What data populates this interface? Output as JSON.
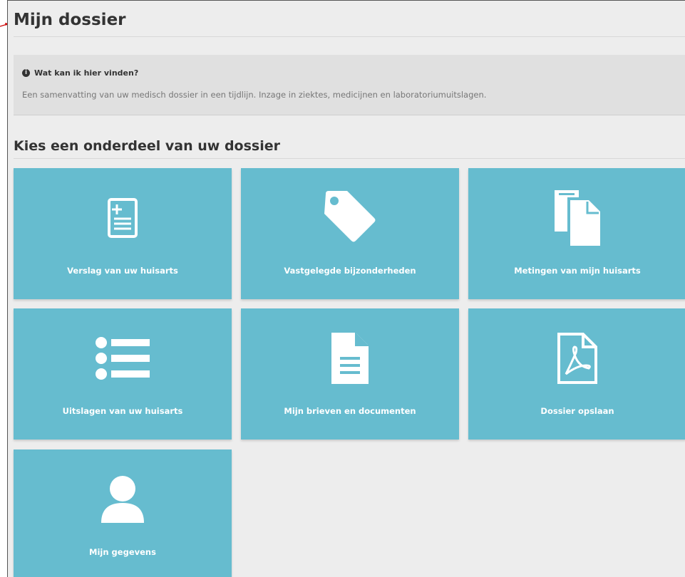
{
  "page": {
    "title": "Mijn dossier"
  },
  "info": {
    "heading": "Wat kan ik hier vinden?",
    "text": "Een samenvatting van uw medisch dossier in een tijdlijn. Inzage in ziektes, medicijnen en laboratoriumuitslagen."
  },
  "section": {
    "title": "Kies een onderdeel van uw dossier"
  },
  "tiles": [
    {
      "label": "Verslag van uw huisarts",
      "icon": "medical-report-icon"
    },
    {
      "label": "Vastgelegde bijzonderheden",
      "icon": "tag-icon"
    },
    {
      "label": "Metingen van mijn huisarts",
      "icon": "documents-icon"
    },
    {
      "label": "Uitslagen van uw huisarts",
      "icon": "list-icon"
    },
    {
      "label": "Mijn brieven en documenten",
      "icon": "document-icon"
    },
    {
      "label": "Dossier opslaan",
      "icon": "pdf-icon"
    },
    {
      "label": "Mijn gegevens",
      "icon": "user-icon"
    }
  ],
  "colors": {
    "tile": "#66bccf",
    "background": "#ededed",
    "accent": "#cc0000"
  }
}
